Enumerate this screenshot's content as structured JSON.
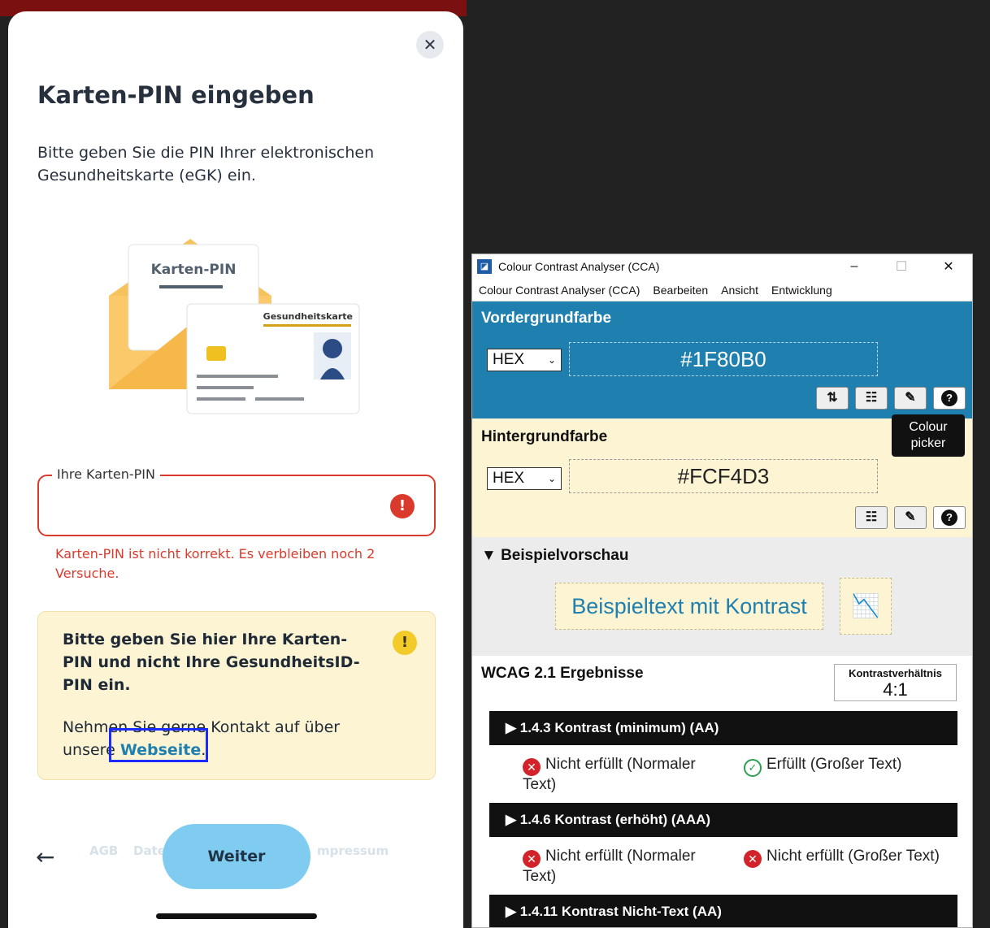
{
  "phone": {
    "close_glyph": "✕",
    "title": "Karten-PIN eingeben",
    "intro": "Bitte geben Sie die PIN Ihrer elektronischen Gesundheitskarte (eGK) ein.",
    "illustration": {
      "letter_label": "Karten-PIN",
      "card_label": "Gesundheitskarte"
    },
    "pin_field": {
      "label": "Ihre Karten-PIN",
      "error_icon": "!",
      "error": "Karten-PIN ist nicht korrekt. Es verbleiben noch 2 Versuche."
    },
    "notice": {
      "bold_text": "Bitte geben Sie hier Ihre Karten-PIN und nicht Ihre GesundheitsID-PIN ein.",
      "warn_icon": "!",
      "contact_prefix": "Nehmen Sie gerne Kontakt auf über unsere",
      "link_text": "Webseite",
      "contact_suffix": "."
    },
    "footer": {
      "back_glyph": "←",
      "faded_links": [
        "AGB",
        "Date",
        "mpressum"
      ],
      "next_button": "Weiter"
    }
  },
  "cca": {
    "title": "Colour Contrast Analyser (CCA)",
    "controls": [
      "–",
      "☐",
      "✕"
    ],
    "menu": [
      "Colour Contrast Analyser (CCA)",
      "Bearbeiten",
      "Ansicht",
      "Entwicklung"
    ],
    "foreground": {
      "title": "Vordergrundfarbe",
      "format": "HEX",
      "value": "#1F80B0",
      "color": "#1F80B0"
    },
    "background": {
      "title": "Hintergrundfarbe",
      "format": "HEX",
      "value": "#FCF4D3",
      "color": "#FCF4D3"
    },
    "tooltip": "Colour picker",
    "preview": {
      "title": "▼ Beispielvorschau",
      "sample_text": "Beispieltext mit Kontrast"
    },
    "wcag": {
      "title": "WCAG 2.1 Ergebnisse",
      "ratio_label": "Kontrastverhältnis",
      "ratio_value": "4:1",
      "criteria": [
        {
          "label": "▶ 1.4.3 Kontrast (minimum) (AA)",
          "normal": "Nicht erfüllt (Normaler Text)",
          "large": "Erfüllt (Großer Text)"
        },
        {
          "label": "▶ 1.4.6 Kontrast (erhöht) (AAA)",
          "normal": "Nicht erfüllt (Normaler Text)",
          "large": "Nicht erfüllt (Großer Text)"
        },
        {
          "label": "▶ 1.4.11 Kontrast Nicht-Text (AA)"
        }
      ]
    }
  }
}
